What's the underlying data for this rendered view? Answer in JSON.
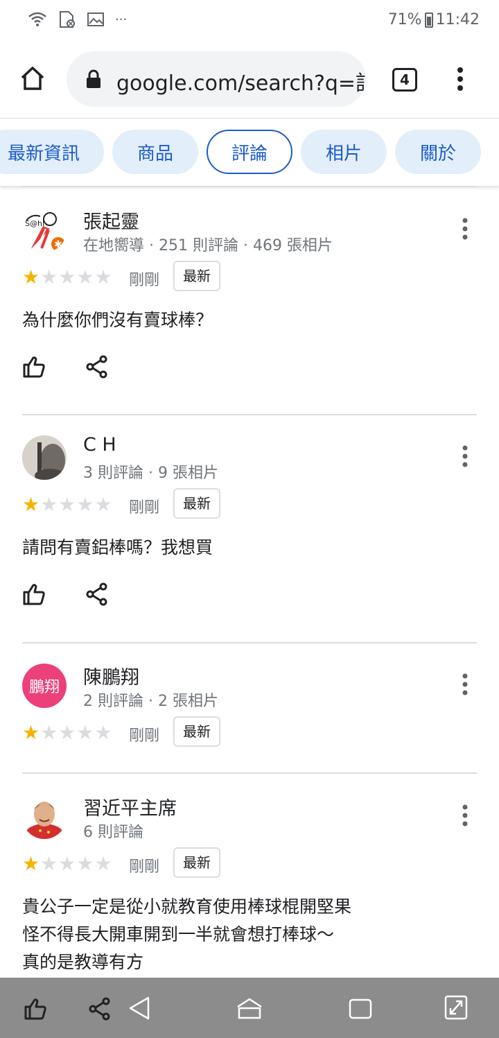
{
  "status_bar": {
    "icons": [
      "wifi-icon",
      "sd-card-icon",
      "image-icon",
      "more-notifications-icon"
    ],
    "more_text": "···",
    "battery_text": "71%",
    "time": "11:42"
  },
  "browser": {
    "url": "google.com/search?q=記",
    "tab_count": "4"
  },
  "chips": [
    {
      "label": "最新資訊",
      "active": false
    },
    {
      "label": "商品",
      "active": false
    },
    {
      "label": "評論",
      "active": true
    },
    {
      "label": "相片",
      "active": false
    },
    {
      "label": "關於",
      "active": false
    }
  ],
  "reviews": [
    {
      "name": "張起靈",
      "meta": "在地嚮導 · 251 則評論 · 469 張相片",
      "rating": 1,
      "time": "剛剛",
      "badge": "最新",
      "text_lines": [
        "為什麼你們沒有賣球棒？"
      ]
    },
    {
      "name": "C H",
      "meta": "3 則評論 · 9 張相片",
      "rating": 1,
      "time": "剛剛",
      "badge": "最新",
      "text_lines": [
        "請問有賣鋁棒嗎？我想買"
      ]
    },
    {
      "name": "陳鵬翔",
      "avatar_text": "鵬翔",
      "avatar_color": "#ec407a",
      "meta": "2 則評論 · 2 張相片",
      "rating": 1,
      "time": "剛剛",
      "badge": "最新",
      "text_lines": []
    },
    {
      "name": "習近平主席",
      "meta": "6 則評論",
      "rating": 1,
      "time": "剛剛",
      "badge": "最新",
      "text_lines": [
        "貴公子一定是從小就教育使用棒球棍開堅果",
        "怪不得長大開車開到一半就會想打棒球～",
        "真的是教導有方"
      ]
    }
  ],
  "colors": {
    "accent": "#1a5cc8",
    "chip_bg": "#e3eefb",
    "star": "#f4b400",
    "nav_bar": "#8c8c8c"
  }
}
